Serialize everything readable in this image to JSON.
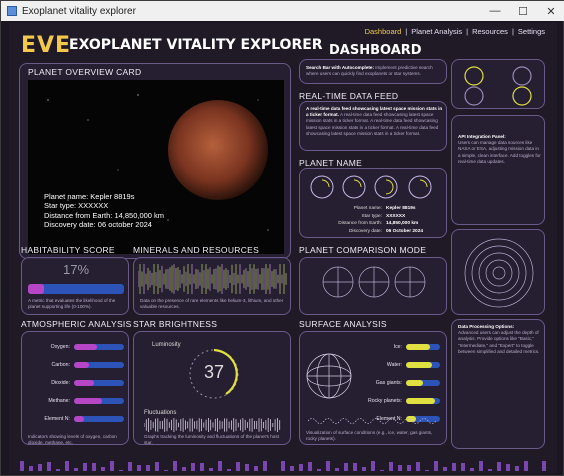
{
  "window": {
    "title": "Exoplanet vitality explorer",
    "min": "—",
    "max": "☐",
    "close": "✕"
  },
  "header": {
    "logo": "EVE",
    "title": "EXOPLANET VITALITY EXPLORER",
    "dashboard": "DASHBOARD",
    "nav": [
      {
        "label": "Dashboard"
      },
      {
        "label": "Planet Analysis"
      },
      {
        "label": "Resources"
      },
      {
        "label": "Settings"
      }
    ],
    "sep": "|"
  },
  "overview": {
    "title": "PLANET OVERVIEW CARD",
    "name": "Planet name: Kepler 8819s",
    "star": "Star type: XXXXXX",
    "distance": "Distance from Earth: 14,850,000 km",
    "discovery": "Discovery date: 06 october 2024"
  },
  "search": {
    "title": "Search Bar with Autocomplete:",
    "desc": "Implement predictive search where users can quickly find exoplanets or star systems."
  },
  "feed": {
    "title": "REAL-TIME DATA FEED",
    "bold": "A real-time data feed showcasing latest space mission stats in a ticker format.",
    "text": "A real-time data feed showcasing latest space mission stats in a ticker format. A real-time data feed showcasing latest space mission stats in a ticker format. A real-time data feed showcasing latest space mission stats in a ticker format."
  },
  "planet_name": {
    "title": "PLANET NAME",
    "rows": [
      {
        "k": "Planet name:",
        "v": "Kepler 8819s"
      },
      {
        "k": "Star type:",
        "v": "XXXXXX"
      },
      {
        "k": "Distance from Earth:",
        "v": "14,850,000 km"
      },
      {
        "k": "Discovery date:",
        "v": "06 October 2024"
      }
    ]
  },
  "api": {
    "title": "API Integration Panel:",
    "desc": "Users can manage data sources like NASA or ESA, adjusting mission data in a simple, clean interface. Add toggles for real-time data updates."
  },
  "habitability": {
    "title": "HABITABILITY SCORE",
    "value": "17%",
    "fraction": 0.17,
    "desc": "A metric that evaluates the likelihood of the planet supporting life (0-100%)."
  },
  "minerals": {
    "title": "MINERALS AND RESOURCES",
    "desc": "Data on the presence of rare elements like helium-3, lithium, and other valuable resources."
  },
  "comparison": {
    "title": "PLANET COMPARISON MODE"
  },
  "atmos": {
    "title": "ATMOSPHERIC ANALYSIS",
    "rows": [
      {
        "label": "Oxygen:",
        "v": 0.45
      },
      {
        "label": "Carbon:",
        "v": 0.3
      },
      {
        "label": "Dioxide:",
        "v": 0.4
      },
      {
        "label": "Methane:",
        "v": 0.55
      },
      {
        "label": "Element N:",
        "v": 0.2
      }
    ],
    "desc": "Indicators showing levels of oxygen, carbon dioxide, methane, etc."
  },
  "star": {
    "title": "STAR BRIGHTNESS",
    "luminosity": "Luminosity",
    "value": "37",
    "fluct": "Fluctuations",
    "desc": "Graphs tracking the luminosity and fluctuations of the planet's host star."
  },
  "surface": {
    "title": "SURFACE ANALYSIS",
    "rows": [
      {
        "label": "Ice:",
        "v": 0.7
      },
      {
        "label": "Water:",
        "v": 0.75
      },
      {
        "label": "Gas giants:",
        "v": 0.5
      },
      {
        "label": "Rocky planets:",
        "v": 0.85
      },
      {
        "label": "Element N:",
        "v": 0.3
      }
    ],
    "desc": "Visualization of surface conditions (e.g., ice, water, gas giants, rocky planets)."
  },
  "processing": {
    "title": "Data Processing Options:",
    "desc": "Advanced users can adjust the depth of analysis. Provide options like \"Basic,\" \"Intermediate,\" and \"Expert\" to toggle between simplified and detailed metrics."
  },
  "colors": {
    "accent": "#f2c94c",
    "bar_bg": "#2c54b8",
    "bar_fill": "#b746c7",
    "border": "#6a5a8a",
    "ring": "#e0e040"
  }
}
